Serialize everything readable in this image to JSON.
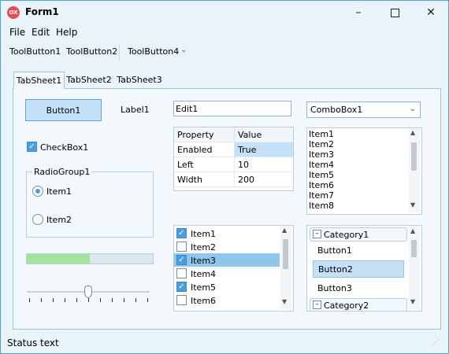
{
  "window": {
    "title": "Form1",
    "app_icon": "OX",
    "minimize_icon": "minimize-icon",
    "maximize_icon": "maximize-icon",
    "close_icon": "close-icon"
  },
  "menu": {
    "items": [
      "File",
      "Edit",
      "Help"
    ]
  },
  "toolbar": {
    "buttons": [
      "ToolButton1",
      "ToolButton2",
      "ToolButton4"
    ]
  },
  "tabs": {
    "labels": [
      "TabSheet1",
      "TabSheet2",
      "TabSheet3"
    ],
    "active": "TabSheet1"
  },
  "controls": {
    "button1": "Button1",
    "label1": "Label1",
    "edit1": "Edit1",
    "combobox1": "ComboBox1",
    "checkbox1": {
      "label": "CheckBox1",
      "checked": true
    },
    "radiogroup1": {
      "label": "RadioGroup1",
      "items": [
        "Item1",
        "Item2"
      ],
      "selected": 0
    },
    "progress": {
      "value": 0.5,
      "color": "#9fe59a"
    },
    "slider": {
      "value": 0.5,
      "ticks": 11
    }
  },
  "grid": {
    "headers": [
      "Property",
      "Value"
    ],
    "rows": [
      [
        "Enabled",
        "True"
      ],
      [
        "Left",
        "10"
      ],
      [
        "Width",
        "200"
      ]
    ],
    "selected_row": 0
  },
  "listbox": {
    "items": [
      "Item1",
      "Item2",
      "Item3",
      "Item4",
      "Item5",
      "Item6",
      "Item7",
      "Item8"
    ]
  },
  "checklist": {
    "items": [
      {
        "label": "Item1",
        "checked": true
      },
      {
        "label": "Item2",
        "checked": false
      },
      {
        "label": "Item3",
        "checked": true
      },
      {
        "label": "Item4",
        "checked": false
      },
      {
        "label": "Item5",
        "checked": true
      },
      {
        "label": "Item6",
        "checked": false
      }
    ],
    "selected": 2
  },
  "categories": [
    {
      "name": "Category1",
      "buttons": [
        "Button1",
        "Button2",
        "Button3"
      ],
      "selected_button": 1
    },
    {
      "name": "Category2",
      "buttons": []
    }
  ],
  "status": {
    "text": "Status text"
  },
  "colors": {
    "accent": "#4a9ee0",
    "selection": "#c5e1f7",
    "border": "#4aa3df"
  }
}
